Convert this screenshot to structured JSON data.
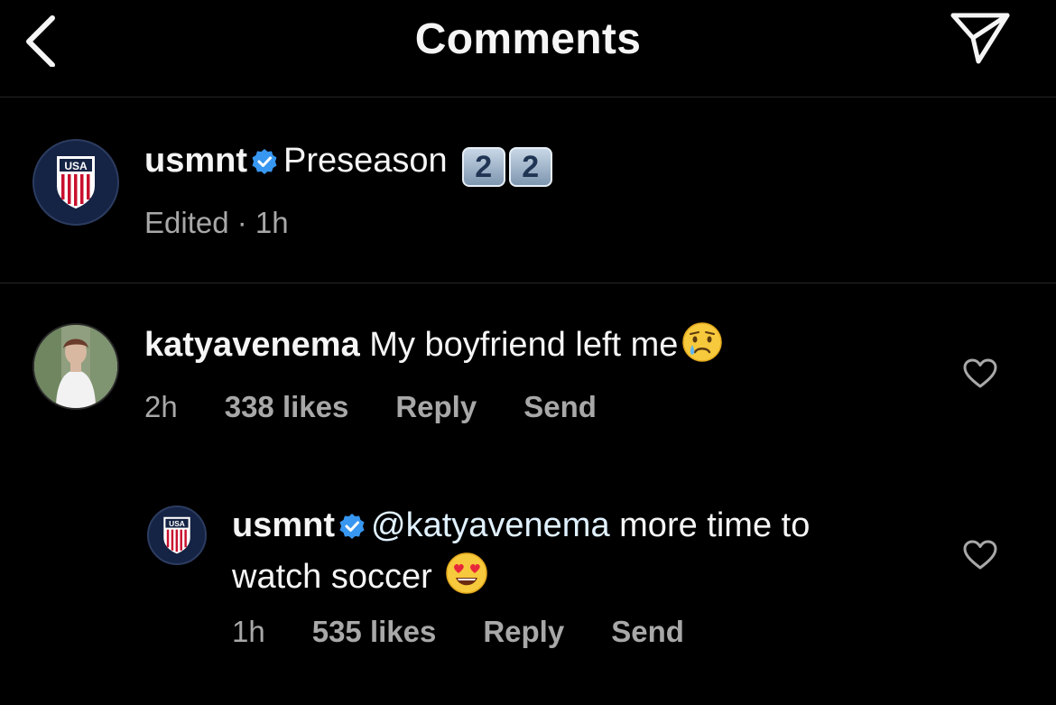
{
  "header": {
    "title": "Comments",
    "back_icon": "chevron-left-icon",
    "share_icon": "paper-plane-icon"
  },
  "caption": {
    "username": "usmnt",
    "text": "Preseason",
    "keycap_1": "2",
    "keycap_2": "2",
    "edited": "Edited · 1h"
  },
  "comments": [
    {
      "username": "katyavenema",
      "text": "My boyfriend left me",
      "emoji": "crying-face-emoji",
      "time": "2h",
      "likes": "338 likes",
      "reply_label": "Reply",
      "send_label": "Send"
    }
  ],
  "replies": [
    {
      "username": "usmnt",
      "mention": "@katyavenema",
      "text_line1": "more time to",
      "text_line2": "watch soccer",
      "emoji": "heart-eyes-emoji",
      "time": "1h",
      "likes": "535 likes",
      "reply_label": "Reply",
      "send_label": "Send"
    }
  ],
  "colors": {
    "background": "#000000",
    "text": "#f5f5f5",
    "secondary": "#a8a8a8",
    "verified": "#3897f0",
    "mention": "#e0f1ff",
    "divider": "#262626"
  }
}
